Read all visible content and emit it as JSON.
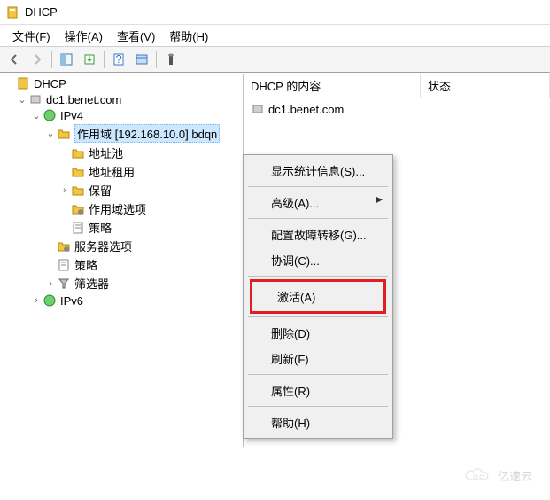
{
  "window": {
    "title": "DHCP"
  },
  "menubar": {
    "file": "文件(F)",
    "action": "操作(A)",
    "view": "查看(V)",
    "help": "帮助(H)"
  },
  "tree": {
    "root": "DHCP",
    "server": "dc1.benet.com",
    "ipv4": "IPv4",
    "scope": "作用域 [192.168.10.0] bdqn",
    "address_pool": "地址池",
    "address_leases": "地址租用",
    "reservations": "保留",
    "scope_options": "作用域选项",
    "policies_scope": "策略",
    "server_options": "服务器选项",
    "policies_server": "策略",
    "filters": "筛选器",
    "ipv6": "IPv6"
  },
  "list": {
    "col_name": "DHCP 的内容",
    "col_status": "状态",
    "row0": "dc1.benet.com"
  },
  "context_menu": {
    "show_stats": "显示统计信息(S)...",
    "advanced": "高级(A)...",
    "configure_failover": "配置故障转移(G)...",
    "reconcile": "协调(C)...",
    "activate": "激活(A)",
    "delete": "删除(D)",
    "refresh": "刷新(F)",
    "properties": "属性(R)",
    "help": "帮助(H)"
  },
  "watermark": "亿速云"
}
